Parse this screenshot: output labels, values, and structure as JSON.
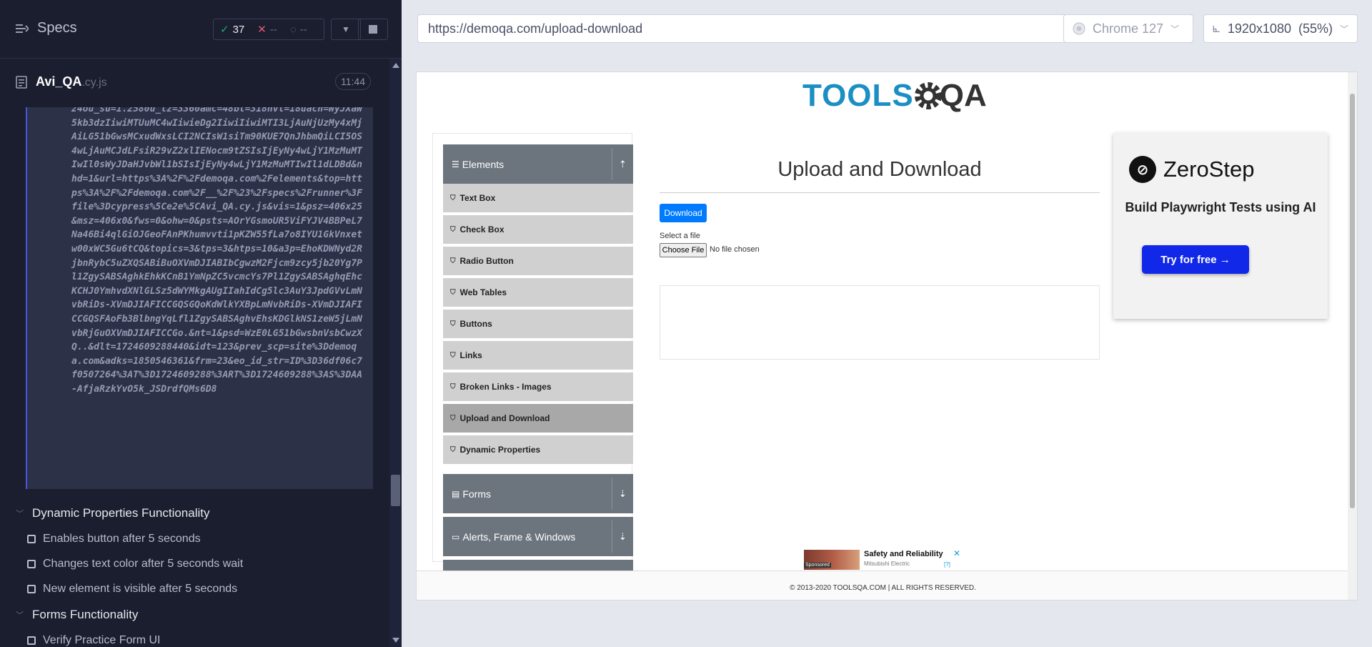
{
  "specs": {
    "title": "Specs",
    "passed": "37",
    "failed": "--",
    "pending": "--"
  },
  "spec_file": {
    "name": "Avi_QA",
    "ext": ".cy.js",
    "duration": "11:44"
  },
  "code_block": {
    "text": "24ou_su=1.2580u_tz=3360amc=48bt=318nvt=18uach=WyJXaW5kb3dzIiwiMTUuMC4wIiwieDg2IiwiIiwiMTI3LjAuNjUzMy4xMjAiLG51bGwsMCxudWxsLCI2NCIsW1siTm90KUE7QnJhbmQiLCI5OS4wLjAuMCJdLFsiR29vZ2xlIENocm9tZSIsIjEyNy4wLjY1MzMuMTIwIl0sWyJDaHJvbWl1bSIsIjEyNy4wLjY1MzMuMTIwIl1dLDBd&nhd=1&url=https%3A%2F%2Fdemoqa.com%2Felements&top=https%3A%2F%2Fdemoqa.com%2F__%2F%23%2Fspecs%2Frunner%3Ffile%3Dcypress%5Ce2e%5CAvi_QA.cy.js&vis=1&psz=406x25&msz=406x0&fws=0&ohw=0&psts=AOrYGsmoUR5ViFYJV4BBPeL7Na46Bi4qlGiOJGeoFAnPKhumvvti1pKZW55fLa7o8IYU1GkVnxetw00xWC5Gu6tCQ&topics=3&tps=3&htps=10&a3p=EhoKDWNyd2RjbnRybC5uZXQSABiBuOXVmDJIABIbCgwzM2Fjcm9zcy5jb20Yg7Pl1ZgySABSAghkEhkKCnB1YmNpZC5vcmcYs7Pl1ZgySABSAghqEhcKCHJ0YmhvdXNlGLSz5dWYMkgAUgIIahIdCg5lc3AuY3JpdGVvLmNvbRiDs-XVmDJIAFICCGQSGQoKdWlkYXBpLmNvbRiDs-XVmDJIAFICCGQSFAoFb3BlbngYqLfl1ZgySABSAghvEhsKDGlkNS1zeW5jLmNvbRjGuOXVmDJIAFICCGo.&nt=1&psd=WzE0LG51bGwsbnVsbCwzXQ..&dlt=1724609288440&idt=123&prev_scp=site%3Ddemoqa.com&adks=1850546361&frm=23&eo_id_str=ID%3D36df06c7f0507264%3AT%3D1724609288%3ART%3D1724609288%3AS%3DAA-AfjaRzkYvO5k_JSDrdfQMs6D8"
  },
  "suites": [
    {
      "title": "Dynamic Properties Functionality",
      "tests": [
        "Enables button after 5 seconds",
        "Changes text color after 5 seconds wait",
        "New element is visible after 5 seconds"
      ]
    },
    {
      "title": "Forms Functionality",
      "tests": [
        "Verify Practice Form UI"
      ]
    }
  ],
  "browser_bar": {
    "url": "https://demoqa.com/upload-download",
    "browser": "Chrome 127",
    "viewport": "1920x1080",
    "zoom": "(55%)"
  },
  "aut": {
    "logo_main": "TOOLS",
    "logo_end": "QA",
    "sidebar": {
      "elements_group": "Elements",
      "items": [
        "Text Box",
        "Check Box",
        "Radio Button",
        "Web Tables",
        "Buttons",
        "Links",
        "Broken Links - Images",
        "Upload and Download",
        "Dynamic Properties"
      ],
      "forms_group": "Forms",
      "alerts_group": "Alerts, Frame & Windows"
    },
    "heading": "Upload and Download",
    "download_label": "Download",
    "select_label": "Select a file",
    "choose_label": "Choose File",
    "no_file": "No file chosen",
    "ad": {
      "brand": "ZeroStep",
      "tagline": "Build Playwright Tests using AI",
      "cta": "Try for free →"
    },
    "bottom_ad": {
      "title": "Safety and Reliability",
      "sponsor": "Mitsubishi Electric",
      "label": "Sponsored",
      "info": "[?]"
    },
    "footer": "© 2013-2020 TOOLSQA.COM | ALL RIGHTS RESERVED."
  },
  "colors": {
    "panel_bg": "#1b1e2e",
    "pass": "#1fa971",
    "fail": "#e45770",
    "accent": "#4956e3",
    "toolsqa_blue": "#1b8fc4",
    "download_btn": "#007bff",
    "cta_blue": "#1128e8"
  },
  "icons": [
    "specs-icon",
    "check-icon",
    "x-icon",
    "spinner-icon",
    "chevron-down-icon",
    "stop-icon",
    "file-icon",
    "chrome-icon",
    "viewport-icon",
    "hamburger-icon",
    "shield-icon",
    "arrow-up-icon",
    "arrow-down-icon"
  ]
}
